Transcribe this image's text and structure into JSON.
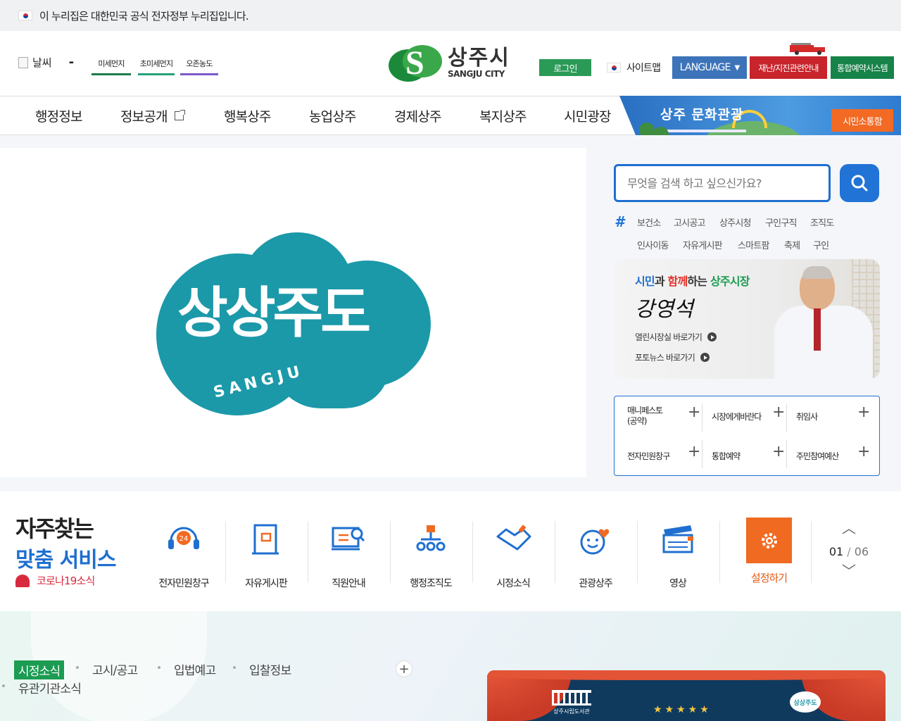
{
  "gov_banner": "이 누리집은 대한민국 공식 전자정부 누리집입니다.",
  "header": {
    "weather_label": "날씨",
    "weather_dash": "-",
    "air": [
      "미세먼지",
      "초미세먼지",
      "오존농도"
    ],
    "logo_ko": "상주시",
    "logo_en": "SANGJU CITY",
    "login": "로그인",
    "sitemap": "사이트맵",
    "language": "LANGUAGE",
    "disaster": "재난/지진관련안내",
    "reserve": "통합예약시스템"
  },
  "nav": {
    "items": [
      "행정정보",
      "정보공개",
      "행복상주",
      "농업상주",
      "경제상주",
      "복지상주",
      "시민광장"
    ],
    "culture_title": "상주 문화관광",
    "civil_button": "시민소통함"
  },
  "hero": {
    "brand_text": "상상주도",
    "brand_sub": "SANGJU"
  },
  "search": {
    "placeholder": "무엇을 검색 하고 싶으신가요?",
    "hash": "#",
    "tags": [
      "보건소",
      "고시공고",
      "상주시청",
      "구인구직",
      "조직도",
      "인사이동",
      "자유게시판",
      "스마트팜",
      "축제",
      "구인"
    ]
  },
  "mayor": {
    "head_parts": [
      "시민",
      "과 ",
      "함께",
      "하는 ",
      "상주시장"
    ],
    "name": "강영석",
    "links": [
      "열린시장실 바로가기",
      "포토뉴스 바로가기"
    ]
  },
  "quick": {
    "cells": [
      "매니페스토\n(공약)",
      "시장에게바란다",
      "취임사",
      "전자민원창구",
      "통합예약",
      "주민참여예산"
    ]
  },
  "services": {
    "title1": "자주찾는",
    "title2": "맞춤 서비스",
    "covid": "코로나19소식",
    "items": [
      "전자민원창구",
      "자유게시판",
      "직원안내",
      "행정조직도",
      "시정소식",
      "관광상주",
      "영상"
    ],
    "setting": "설정하기",
    "page_current": "01",
    "page_total": "06",
    "badge_24": "24"
  },
  "news": {
    "tabs": [
      "시정소식",
      "고시/공고",
      "입법예고",
      "입찰정보",
      "유관기관소식"
    ],
    "plus": "+"
  },
  "banner": {
    "stars": "★★★★★",
    "lib_text": "상주시립도서관",
    "brand": "상상주도"
  },
  "colors": {
    "primary_blue": "#2173d6",
    "green": "#1b9c52",
    "orange": "#f06a22",
    "red": "#c8242b",
    "brand_teal": "#1b99a9"
  }
}
